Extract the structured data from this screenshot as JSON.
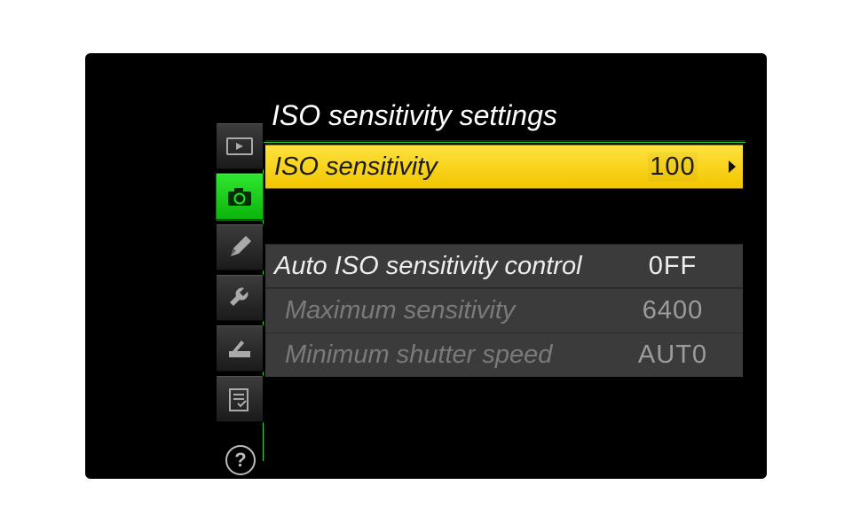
{
  "title": "ISO sensitivity settings",
  "sidebar": {
    "tabs": [
      {
        "name": "playback",
        "active": false
      },
      {
        "name": "shooting",
        "active": true
      },
      {
        "name": "custom",
        "active": false
      },
      {
        "name": "setup",
        "active": false
      },
      {
        "name": "retouch",
        "active": false
      },
      {
        "name": "mymenu",
        "active": false
      }
    ]
  },
  "help_label": "?",
  "rows": {
    "iso": {
      "label": "ISO sensitivity",
      "value": "100"
    },
    "auto": {
      "label": "Auto ISO sensitivity control",
      "value": "0FF"
    },
    "maxsens": {
      "label": "Maximum sensitivity",
      "value": "6400"
    },
    "minshutter": {
      "label": "Minimum shutter speed",
      "value": "AUT0"
    }
  },
  "colors": {
    "highlight": "#f8d31c",
    "active_tab": "#1fcf1f",
    "frame": "#2fdc2f"
  }
}
